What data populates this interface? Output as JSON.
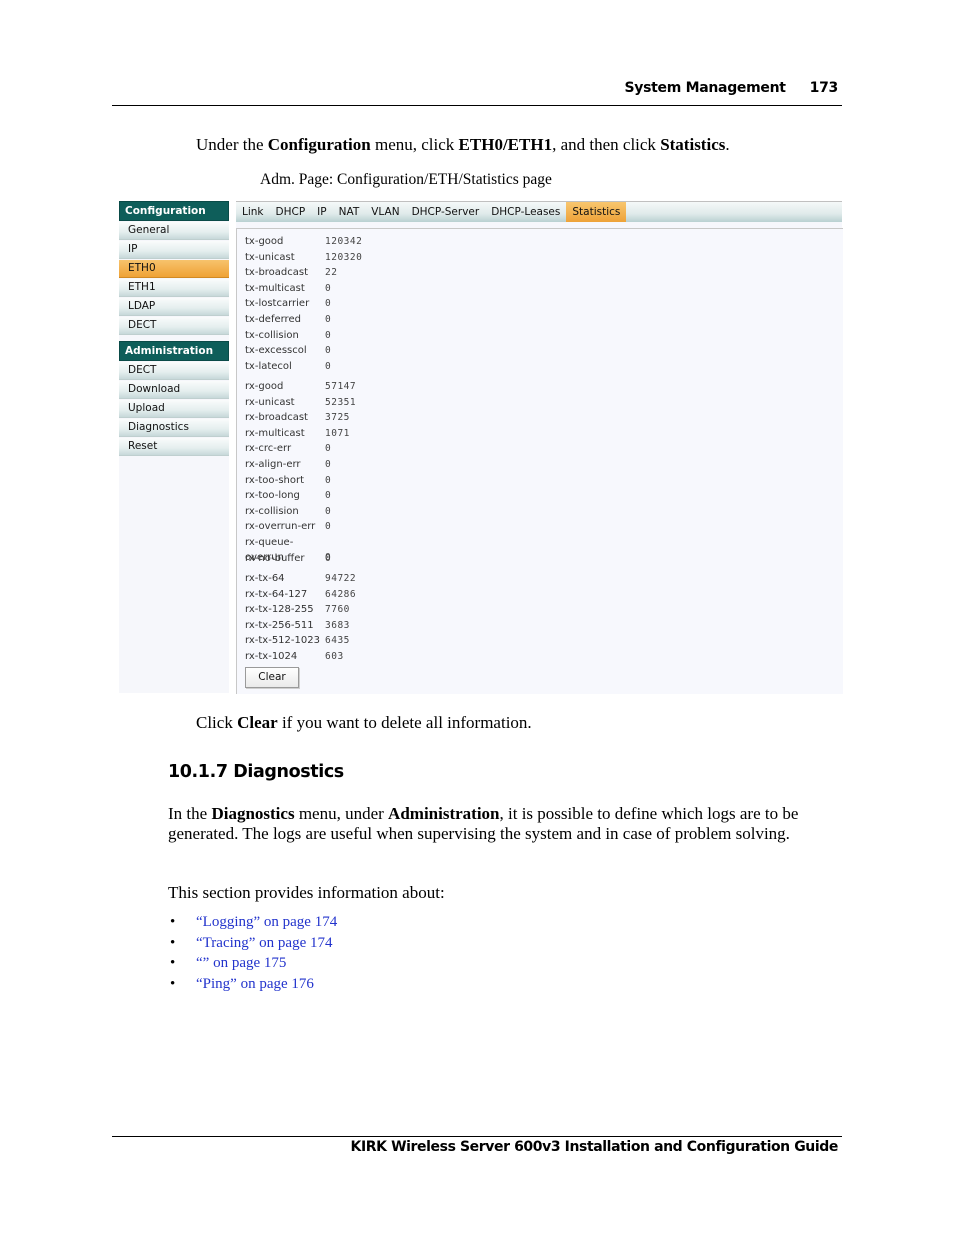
{
  "header": {
    "section": "System Management",
    "page_number": "173"
  },
  "intro": {
    "parts": [
      "Under the ",
      "Configuration",
      " menu, click ",
      "ETH0/ETH1",
      ", and then click ",
      "Statistics",
      "."
    ]
  },
  "caption": "Adm. Page: Configuration/ETH/Statistics page",
  "screenshot": {
    "sidebar": {
      "config_header": "Configuration",
      "config_items": [
        "General",
        "IP",
        "ETH0",
        "ETH1",
        "LDAP",
        "DECT"
      ],
      "config_active": "ETH0",
      "admin_header": "Administration",
      "admin_items": [
        "DECT",
        "Download",
        "Upload",
        "Diagnostics",
        "Reset"
      ]
    },
    "tabs": [
      "Link",
      "DHCP",
      "IP",
      "NAT",
      "VLAN",
      "DHCP-Server",
      "DHCP-Leases",
      "Statistics"
    ],
    "active_tab": "Statistics",
    "stats": {
      "tx": [
        {
          "label": "tx-good",
          "value": "120342"
        },
        {
          "label": "tx-unicast",
          "value": "120320"
        },
        {
          "label": "tx-broadcast",
          "value": "22"
        },
        {
          "label": "tx-multicast",
          "value": "0"
        },
        {
          "label": "tx-lostcarrier",
          "value": "0"
        },
        {
          "label": "tx-deferred",
          "value": "0"
        },
        {
          "label": "tx-collision",
          "value": "0"
        },
        {
          "label": "tx-excesscol",
          "value": "0"
        },
        {
          "label": "tx-latecol",
          "value": "0"
        }
      ],
      "rx": [
        {
          "label": "rx-good",
          "value": "57147"
        },
        {
          "label": "rx-unicast",
          "value": "52351"
        },
        {
          "label": "rx-broadcast",
          "value": "3725"
        },
        {
          "label": "rx-multicast",
          "value": "1071"
        },
        {
          "label": "rx-crc-err",
          "value": "0"
        },
        {
          "label": "rx-align-err",
          "value": "0"
        },
        {
          "label": "rx-too-short",
          "value": "0"
        },
        {
          "label": "rx-too-long",
          "value": "0"
        },
        {
          "label": "rx-collision",
          "value": "0"
        },
        {
          "label": "rx-overrun-err",
          "value": "0"
        },
        {
          "label": "rx-queue-overrun",
          "value": "0"
        },
        {
          "label": "rx-no-buffer",
          "value": "0"
        }
      ],
      "rxtx": [
        {
          "label": "rx-tx-64",
          "value": "94722"
        },
        {
          "label": "rx-tx-64-127",
          "value": "64286"
        },
        {
          "label": "rx-tx-128-255",
          "value": "7760"
        },
        {
          "label": "rx-tx-256-511",
          "value": "3683"
        },
        {
          "label": "rx-tx-512-1023",
          "value": "6435"
        },
        {
          "label": "rx-tx-1024",
          "value": "603"
        }
      ]
    },
    "clear_button": "Clear"
  },
  "clear_note": {
    "parts": [
      "Click ",
      "Clear",
      " if you want to delete all information."
    ]
  },
  "section": {
    "heading": "10.1.7  Diagnostics",
    "para1_parts": [
      "In the ",
      "Diagnostics",
      " menu, under ",
      "Administration",
      ", it is possible to define which logs are to be generated. The logs are useful when supervising the system and in case of problem solving."
    ],
    "para2": "This section provides information about:",
    "links": [
      "“Logging” on page 174",
      "“Tracing” on page 174",
      "“” on page 175",
      "“Ping” on page 176"
    ]
  },
  "footer": "KIRK Wireless Server 600v3 Installation and Configuration Guide"
}
